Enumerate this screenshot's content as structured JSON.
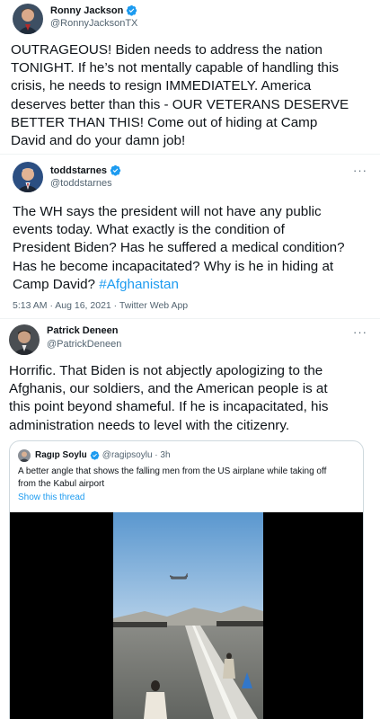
{
  "colors": {
    "accent": "#1d9bf0",
    "text": "#0f1419",
    "secondary": "#536471",
    "border": "#cfd9de"
  },
  "tweet1": {
    "name": "Ronny Jackson",
    "handle": "@RonnyJacksonTX",
    "lines": [
      "OUTRAGEOUS! Biden needs to address the nation",
      "TONIGHT. If he’s not mentally capable of handling this",
      "crisis, he needs to resign IMMEDIATELY. America",
      "deserves better than this - OUR VETERANS DESERVE",
      "BETTER THAN THIS! Come out of hiding at Camp",
      "David and do your damn job!"
    ]
  },
  "tweet2": {
    "name": "toddstarnes",
    "handle": "@toddstarnes",
    "more": "···",
    "lines": [
      "The WH says the president will not have any public",
      "events today. What exactly is the condition of",
      "President Biden? Has he suffered a medical condition?",
      "Has he become incapacitated? Why is he in hiding at",
      "Camp David?"
    ],
    "hashtag": "#Afghanistan",
    "timestamp": "5:13 AM · Aug 16, 2021 · Twitter Web App"
  },
  "tweet3": {
    "name": "Patrick Deneen",
    "handle": "@PatrickDeneen",
    "more": "···",
    "lines": [
      "Horrific. That Biden is not abjectly apologizing to the",
      "Afghanis, our soldiers, and the American people is at",
      "this point beyond shameful.  If he is incapacitated, his",
      "administration needs to level with the citizenry."
    ]
  },
  "quote": {
    "name": "Ragıp Soylu",
    "handle": "@ragipsoylu · 3h",
    "lines": [
      "A better angle that shows the falling men from the US airplane while taking off",
      "from the Kabul airport"
    ],
    "show_thread": "Show this thread"
  }
}
